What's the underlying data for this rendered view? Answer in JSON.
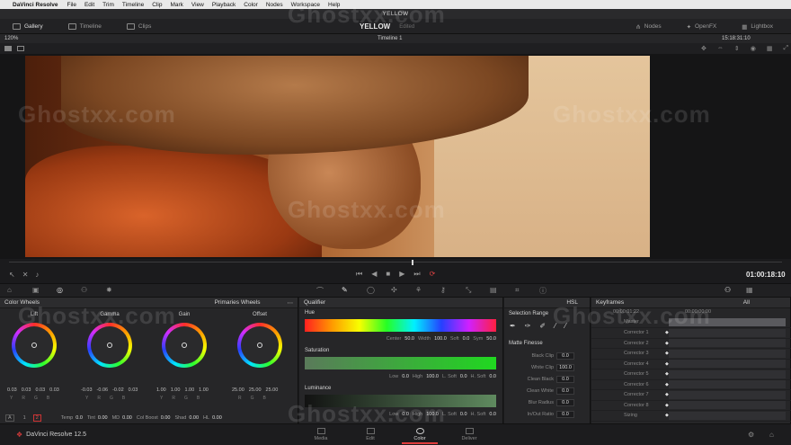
{
  "menubar": {
    "app": "DaVinci Resolve",
    "items": [
      "File",
      "Edit",
      "Trim",
      "Timeline",
      "Clip",
      "Mark",
      "View",
      "Playback",
      "Color",
      "Nodes",
      "Workspace",
      "Help"
    ]
  },
  "window": {
    "title": "YELLOW"
  },
  "toolbar": {
    "left": [
      "Gallery",
      "Timeline",
      "Clips"
    ],
    "clip_name": "YELLOW",
    "clip_sub": "Edited",
    "right": [
      "Nodes",
      "OpenFX",
      "Lightbox"
    ]
  },
  "viewer": {
    "zoom": "120%",
    "timeline_name": "Timeline 1",
    "timecode": "15:18:31:10"
  },
  "transport": {
    "timecode": "01:00:18:10"
  },
  "wheels": {
    "title": "Color Wheels",
    "mode": "Primaries Wheels",
    "items": [
      {
        "label": "Lift",
        "values": [
          "0.03",
          "0.03",
          "0.03",
          "0.03"
        ]
      },
      {
        "label": "Gamma",
        "values": [
          "-0.03",
          "-0.06",
          "-0.02",
          "0.03"
        ]
      },
      {
        "label": "Gain",
        "values": [
          "1.00",
          "1.00",
          "1.00",
          "1.00"
        ]
      },
      {
        "label": "Offset",
        "values": [
          "25.00",
          "25.00",
          "25.00"
        ]
      }
    ],
    "keys4": [
      "Y",
      "R",
      "G",
      "B"
    ],
    "keys3": [
      "R",
      "G",
      "B"
    ],
    "footer": {
      "tab_a": "A",
      "tab_1": "1",
      "tab_2": "2",
      "temp_label": "Temp",
      "temp": "0.0",
      "tint_label": "Tint",
      "tint": "0.00",
      "md_label": "MD",
      "md": "0.00",
      "colboost_label": "Col Boost",
      "colboost": "0.00",
      "shad_label": "Shad",
      "shad": "0.00",
      "hl_label": "HL",
      "hl": "0.00"
    }
  },
  "qualifier": {
    "title": "Qualifier",
    "mode": "HSL",
    "hue": {
      "label": "Hue",
      "center_label": "Center",
      "center": "50.0",
      "width_label": "Width",
      "width": "100.0",
      "soft_label": "Soft",
      "soft": "0.0",
      "sym_label": "Sym",
      "sym": "50.0"
    },
    "saturation": {
      "label": "Saturation",
      "low_label": "Low",
      "low": "0.0",
      "high_label": "High",
      "high": "100.0",
      "lsoft_label": "L. Soft",
      "lsoft": "0.0",
      "hsoft_label": "H. Soft",
      "hsoft": "0.0"
    },
    "luminance": {
      "label": "Luminance",
      "low_label": "Low",
      "low": "0.0",
      "high_label": "High",
      "high": "100.0",
      "lsoft_label": "L. Soft",
      "lsoft": "0.0",
      "hsoft_label": "H. Soft",
      "hsoft": "0.0"
    }
  },
  "selection": {
    "title": "Selection Range",
    "matte_title": "Matte Finesse",
    "rows": [
      {
        "label": "Black Clip",
        "value": "0.0"
      },
      {
        "label": "White Clip",
        "value": "100.0"
      },
      {
        "label": "Clean Black",
        "value": "0.0"
      },
      {
        "label": "Clean White",
        "value": "0.0"
      },
      {
        "label": "Blur Radius",
        "value": "0.0"
      },
      {
        "label": "In/Out Ratio",
        "value": "0.0"
      }
    ]
  },
  "keyframes": {
    "title": "Keyframes",
    "filter": "All",
    "tc_left": "00:00:01:22",
    "tc_right": "00:00:00:00",
    "rows": [
      "Master",
      "Corrector 1",
      "Corrector 2",
      "Corrector 3",
      "Corrector 4",
      "Corrector 5",
      "Corrector 6",
      "Corrector 7",
      "Corrector 8",
      "Sizing"
    ]
  },
  "pages": {
    "brand": "DaVinci Resolve 12.5",
    "tabs": [
      "Media",
      "Edit",
      "Color",
      "Deliver"
    ],
    "active": "Color"
  },
  "watermark": "Ghostxx.com"
}
